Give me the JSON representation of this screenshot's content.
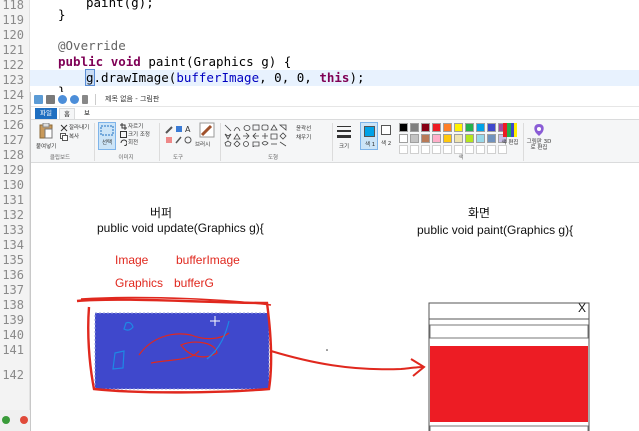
{
  "editor": {
    "line_numbers": [
      "118",
      "119",
      "120",
      "121",
      "122",
      "123",
      "124",
      "125",
      "126",
      "127",
      "128",
      "129",
      "130",
      "131",
      "132",
      "133",
      "134",
      "135",
      "136",
      "137",
      "138",
      "139",
      "140",
      "141",
      "142"
    ],
    "code": {
      "l118": "paint(g);",
      "l119": "}",
      "l121_annotation": "@Override",
      "l122_kw1": "public",
      "l122_kw2": "void",
      "l122_rest": " paint(Graphics g) {",
      "l123_sel": "g",
      "l123_mid": ".drawImage(",
      "l123_field": "bufferImage",
      "l123_args": ", 0, 0, ",
      "l123_this": "this",
      "l123_end": ");",
      "l124": "}"
    }
  },
  "paint": {
    "title": "제목 없음 - 그림판",
    "tabs": {
      "file": "파일",
      "home": "홈",
      "view": "보기"
    },
    "ribbon": {
      "clipboard": {
        "paste": "붙여넣기",
        "cut": "잘라내기",
        "copy": "복사",
        "label": "클립보드"
      },
      "image": {
        "select": "선택",
        "crop": "자르기",
        "resize": "크기 조정",
        "rotate": "회전",
        "label": "이미지"
      },
      "tools": {
        "label": "도구"
      },
      "brushes": {
        "label": "브러시"
      },
      "shapes": {
        "outline": "윤곽선",
        "fill": "채우기",
        "label": "도형"
      },
      "size": {
        "label": "크기"
      },
      "color1": {
        "label": "색 1"
      },
      "color2": {
        "label": "색 2"
      },
      "colors": {
        "label": "색"
      },
      "edit_colors": {
        "label": "색 편집"
      },
      "paint3d": {
        "label": "그림판 3D로 편집"
      }
    },
    "palette": [
      "#000000",
      "#7f7f7f",
      "#880015",
      "#ed1c24",
      "#ff7f27",
      "#fff200",
      "#22b14c",
      "#00a2e8",
      "#3f48cc",
      "#a349a4",
      "#ffffff",
      "#c3c3c3",
      "#b97a57",
      "#ffaec9",
      "#ffc90e",
      "#efe4b0",
      "#b5e61d",
      "#99d9ea",
      "#7092be",
      "#c8bfe7"
    ],
    "canvas": {
      "left_title": "버퍼",
      "left_method": "public void update(Graphics g){",
      "right_title": "화면",
      "right_method": "public void paint(Graphics g){",
      "type_image": "Image",
      "var_image": "bufferImage",
      "type_graphics": "Graphics",
      "var_graphics": "bufferG",
      "close_mark": "X"
    },
    "colors": {
      "buffer_fill": "#3f48cc",
      "ink_red": "#e0281e",
      "screen_red": "#ed1c24",
      "accent": "#1f6fc1"
    }
  }
}
